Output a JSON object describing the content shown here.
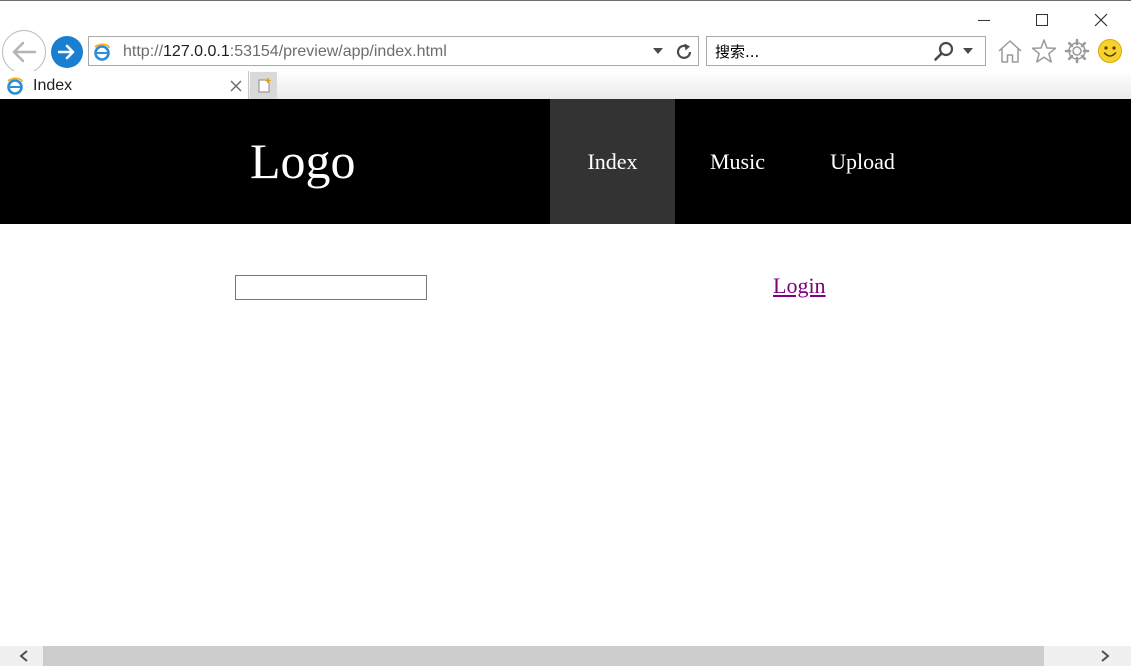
{
  "browser": {
    "address": {
      "scheme": "http://",
      "host": "127.0.0.1",
      "rest": ":53154/preview/app/index.html"
    },
    "search": {
      "placeholder": "搜索..."
    },
    "tab": {
      "title": "Index"
    }
  },
  "site": {
    "logo": "Logo",
    "nav": [
      {
        "label": "Index",
        "active": true
      },
      {
        "label": "Music",
        "active": false
      },
      {
        "label": "Upload",
        "active": false
      }
    ],
    "search_value": "",
    "login_label": "Login"
  },
  "colors": {
    "header_bg": "#000000",
    "nav_active_bg": "#333333",
    "link_visited": "#800080",
    "forward_button": "#1a7fd0"
  }
}
